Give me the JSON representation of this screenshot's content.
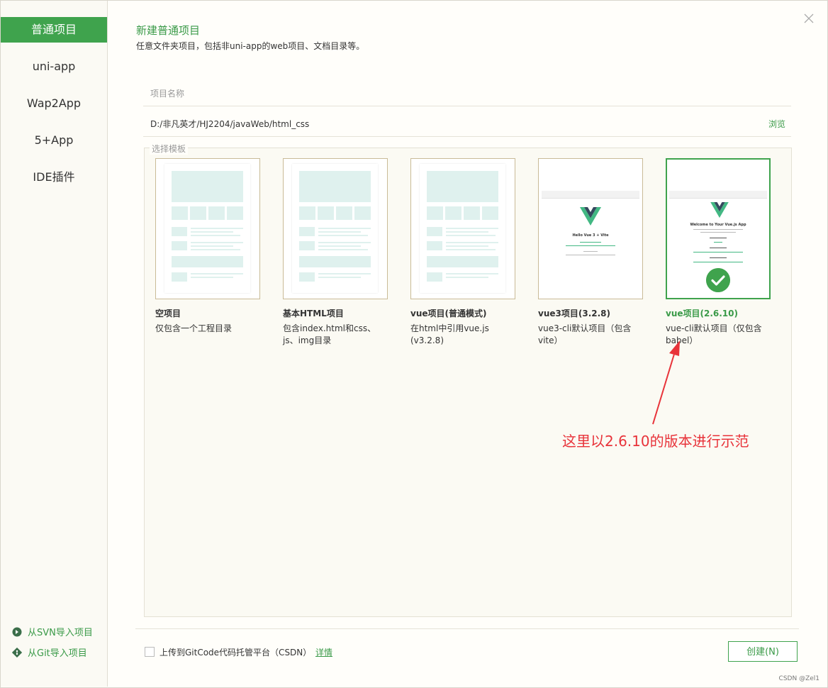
{
  "sidebar": {
    "items": [
      {
        "label": "普通项目"
      },
      {
        "label": "uni-app"
      },
      {
        "label": "Wap2App"
      },
      {
        "label": "5+App"
      },
      {
        "label": "IDE插件"
      }
    ],
    "svn_import": "从SVN导入项目",
    "git_import": "从Git导入项目"
  },
  "header": {
    "title": "新建普通项目",
    "description": "任意文件夹项目，包括非uni-app的web项目、文档目录等。"
  },
  "form": {
    "name_placeholder": "项目名称",
    "path_value": "D:/非凡英才/HJ2204/javaWeb/html_css",
    "browse_label": "浏览"
  },
  "templates": {
    "legend": "选择模板",
    "items": [
      {
        "title": "空项目",
        "description": "仅包含一个工程目录"
      },
      {
        "title": "基本HTML项目",
        "description": "包含index.html和css、js、img目录"
      },
      {
        "title": "vue项目(普通模式)",
        "description": "在html中引用vue.js (v3.2.8)"
      },
      {
        "title": "vue3项目(3.2.8)",
        "description": "vue3-cli默认项目（包含vite）",
        "preview_caption": "Hello Vue 3 + Vite"
      },
      {
        "title": "vue项目(2.6.10)",
        "description": "vue-cli默认项目（仅包含babel）",
        "preview_caption": "Welcome to Your Vue.js App",
        "selected": true
      }
    ]
  },
  "annotation": {
    "text": "这里以2.6.10的版本进行示范",
    "color": "#e8333a"
  },
  "footer": {
    "upload_label": "上传到GitCode代码托管平台（CSDN）",
    "detail_link": "详情",
    "create_button": "创建(N)"
  },
  "watermark": "CSDN @Zel1",
  "colors": {
    "accent": "#3fa34d",
    "template_border": "#c9bb97"
  }
}
